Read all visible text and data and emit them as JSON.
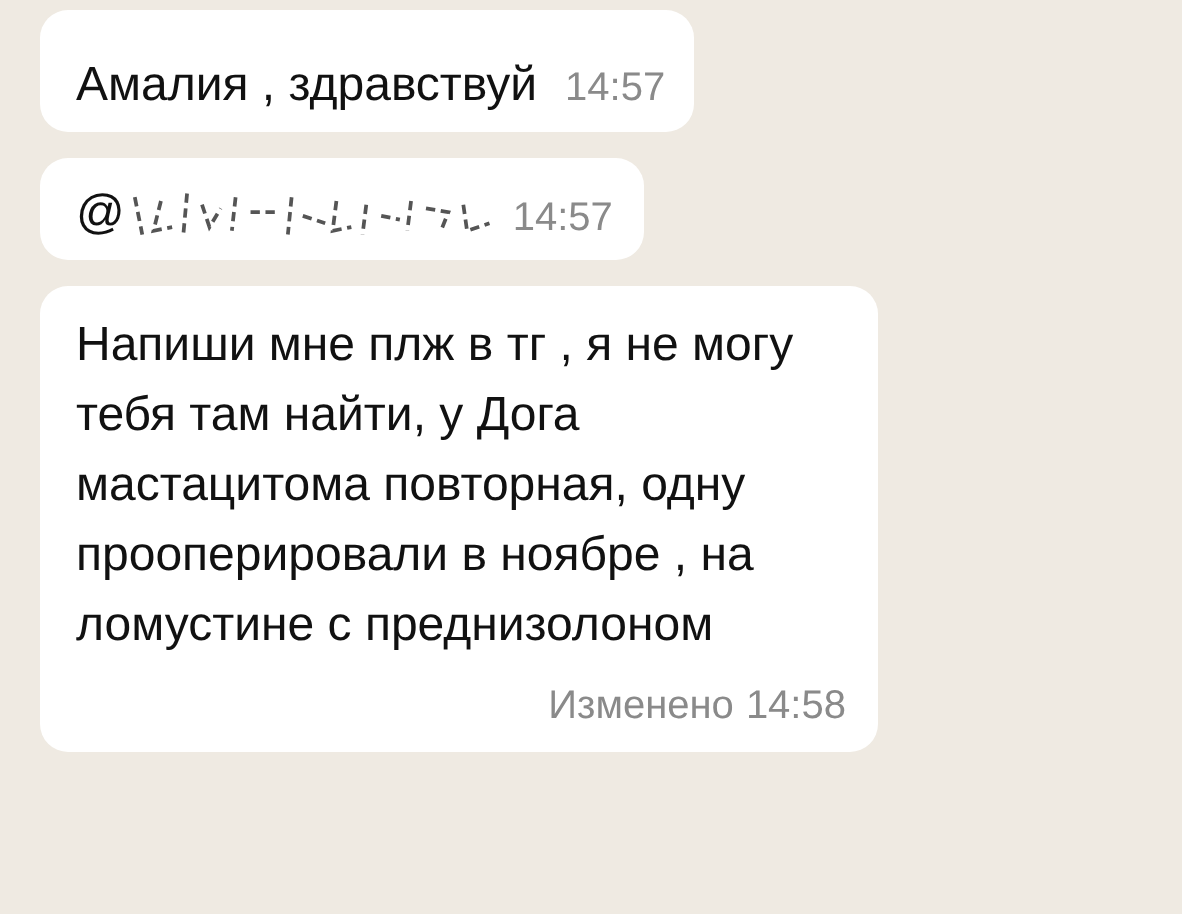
{
  "messages": [
    {
      "kind": "text",
      "text": "Амалия , здравствуй",
      "time": "14:57"
    },
    {
      "kind": "mention",
      "text": "@",
      "redacted": true,
      "time": "14:57"
    },
    {
      "kind": "text",
      "text": "Напиши мне плж в тг , я не могу тебя там найти, у Дога мастацитома повторная, одну прооперировали в ноябре , на ломустине с преднизолоном",
      "edited_label": "Изменено",
      "time": "14:58"
    }
  ]
}
